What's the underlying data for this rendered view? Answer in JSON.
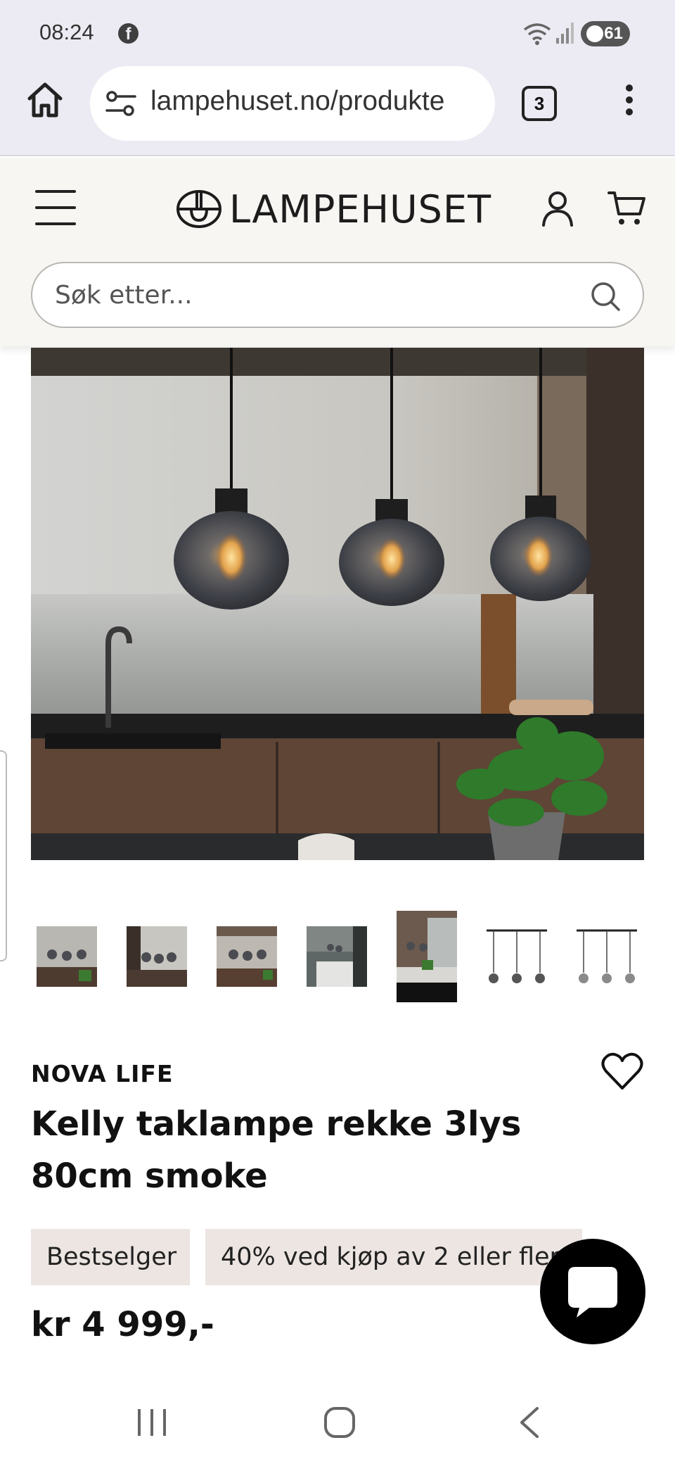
{
  "status_bar": {
    "time": "08:24",
    "notification_icon": "facebook-icon",
    "battery": "61"
  },
  "browser": {
    "url": "lampehuset.no/produkte",
    "tab_count": "3"
  },
  "site": {
    "logo_text": "LAMPEHUSET",
    "search_placeholder": "Søk etter..."
  },
  "product": {
    "brand": "NOVA LIFE",
    "title": "Kelly taklampe rekke 3lys 80cm smoke",
    "badges": [
      "Bestselger",
      "40% ved kjøp av 2 eller flere"
    ],
    "price": "kr 4 999,-",
    "thumbnail_count": 7,
    "selected_thumbnail": 5
  },
  "colors": {
    "header_bg": "#f8f6f2",
    "browser_bg": "#ecebf3",
    "badge_bg": "#ece5e1",
    "chat_button": "#000000"
  }
}
